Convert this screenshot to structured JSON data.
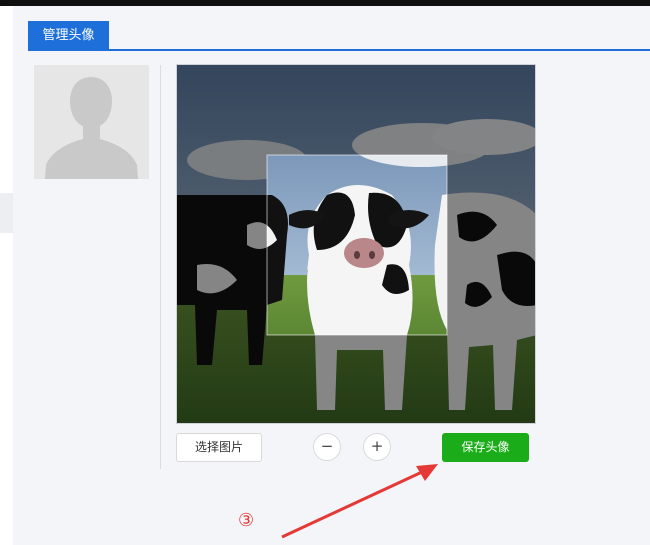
{
  "tab": {
    "label": "管理头像"
  },
  "avatar": {
    "icon": "user-silhouette-icon"
  },
  "cropper": {
    "image": "cow-photo"
  },
  "buttons": {
    "select_image": "选择图片",
    "zoom_out": "−",
    "zoom_in": "+",
    "save_avatar": "保存头像"
  },
  "annotation": {
    "step": "③",
    "color": "#e53935"
  },
  "colors": {
    "accent": "#1e6fd9",
    "save": "#1aad19"
  }
}
